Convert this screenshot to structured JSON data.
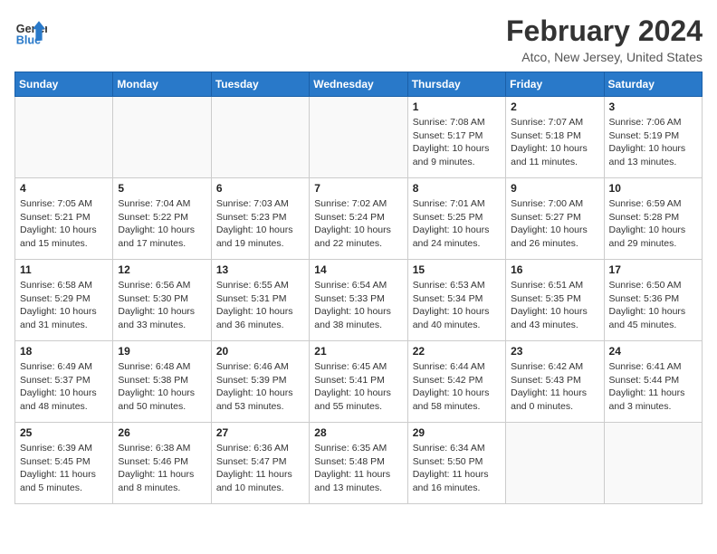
{
  "logo": {
    "line1": "General",
    "line2": "Blue"
  },
  "title": "February 2024",
  "location": "Atco, New Jersey, United States",
  "days_of_week": [
    "Sunday",
    "Monday",
    "Tuesday",
    "Wednesday",
    "Thursday",
    "Friday",
    "Saturday"
  ],
  "weeks": [
    [
      {
        "day": "",
        "info": ""
      },
      {
        "day": "",
        "info": ""
      },
      {
        "day": "",
        "info": ""
      },
      {
        "day": "",
        "info": ""
      },
      {
        "day": "1",
        "info": "Sunrise: 7:08 AM\nSunset: 5:17 PM\nDaylight: 10 hours\nand 9 minutes."
      },
      {
        "day": "2",
        "info": "Sunrise: 7:07 AM\nSunset: 5:18 PM\nDaylight: 10 hours\nand 11 minutes."
      },
      {
        "day": "3",
        "info": "Sunrise: 7:06 AM\nSunset: 5:19 PM\nDaylight: 10 hours\nand 13 minutes."
      }
    ],
    [
      {
        "day": "4",
        "info": "Sunrise: 7:05 AM\nSunset: 5:21 PM\nDaylight: 10 hours\nand 15 minutes."
      },
      {
        "day": "5",
        "info": "Sunrise: 7:04 AM\nSunset: 5:22 PM\nDaylight: 10 hours\nand 17 minutes."
      },
      {
        "day": "6",
        "info": "Sunrise: 7:03 AM\nSunset: 5:23 PM\nDaylight: 10 hours\nand 19 minutes."
      },
      {
        "day": "7",
        "info": "Sunrise: 7:02 AM\nSunset: 5:24 PM\nDaylight: 10 hours\nand 22 minutes."
      },
      {
        "day": "8",
        "info": "Sunrise: 7:01 AM\nSunset: 5:25 PM\nDaylight: 10 hours\nand 24 minutes."
      },
      {
        "day": "9",
        "info": "Sunrise: 7:00 AM\nSunset: 5:27 PM\nDaylight: 10 hours\nand 26 minutes."
      },
      {
        "day": "10",
        "info": "Sunrise: 6:59 AM\nSunset: 5:28 PM\nDaylight: 10 hours\nand 29 minutes."
      }
    ],
    [
      {
        "day": "11",
        "info": "Sunrise: 6:58 AM\nSunset: 5:29 PM\nDaylight: 10 hours\nand 31 minutes."
      },
      {
        "day": "12",
        "info": "Sunrise: 6:56 AM\nSunset: 5:30 PM\nDaylight: 10 hours\nand 33 minutes."
      },
      {
        "day": "13",
        "info": "Sunrise: 6:55 AM\nSunset: 5:31 PM\nDaylight: 10 hours\nand 36 minutes."
      },
      {
        "day": "14",
        "info": "Sunrise: 6:54 AM\nSunset: 5:33 PM\nDaylight: 10 hours\nand 38 minutes."
      },
      {
        "day": "15",
        "info": "Sunrise: 6:53 AM\nSunset: 5:34 PM\nDaylight: 10 hours\nand 40 minutes."
      },
      {
        "day": "16",
        "info": "Sunrise: 6:51 AM\nSunset: 5:35 PM\nDaylight: 10 hours\nand 43 minutes."
      },
      {
        "day": "17",
        "info": "Sunrise: 6:50 AM\nSunset: 5:36 PM\nDaylight: 10 hours\nand 45 minutes."
      }
    ],
    [
      {
        "day": "18",
        "info": "Sunrise: 6:49 AM\nSunset: 5:37 PM\nDaylight: 10 hours\nand 48 minutes."
      },
      {
        "day": "19",
        "info": "Sunrise: 6:48 AM\nSunset: 5:38 PM\nDaylight: 10 hours\nand 50 minutes."
      },
      {
        "day": "20",
        "info": "Sunrise: 6:46 AM\nSunset: 5:39 PM\nDaylight: 10 hours\nand 53 minutes."
      },
      {
        "day": "21",
        "info": "Sunrise: 6:45 AM\nSunset: 5:41 PM\nDaylight: 10 hours\nand 55 minutes."
      },
      {
        "day": "22",
        "info": "Sunrise: 6:44 AM\nSunset: 5:42 PM\nDaylight: 10 hours\nand 58 minutes."
      },
      {
        "day": "23",
        "info": "Sunrise: 6:42 AM\nSunset: 5:43 PM\nDaylight: 11 hours\nand 0 minutes."
      },
      {
        "day": "24",
        "info": "Sunrise: 6:41 AM\nSunset: 5:44 PM\nDaylight: 11 hours\nand 3 minutes."
      }
    ],
    [
      {
        "day": "25",
        "info": "Sunrise: 6:39 AM\nSunset: 5:45 PM\nDaylight: 11 hours\nand 5 minutes."
      },
      {
        "day": "26",
        "info": "Sunrise: 6:38 AM\nSunset: 5:46 PM\nDaylight: 11 hours\nand 8 minutes."
      },
      {
        "day": "27",
        "info": "Sunrise: 6:36 AM\nSunset: 5:47 PM\nDaylight: 11 hours\nand 10 minutes."
      },
      {
        "day": "28",
        "info": "Sunrise: 6:35 AM\nSunset: 5:48 PM\nDaylight: 11 hours\nand 13 minutes."
      },
      {
        "day": "29",
        "info": "Sunrise: 6:34 AM\nSunset: 5:50 PM\nDaylight: 11 hours\nand 16 minutes."
      },
      {
        "day": "",
        "info": ""
      },
      {
        "day": "",
        "info": ""
      }
    ]
  ]
}
